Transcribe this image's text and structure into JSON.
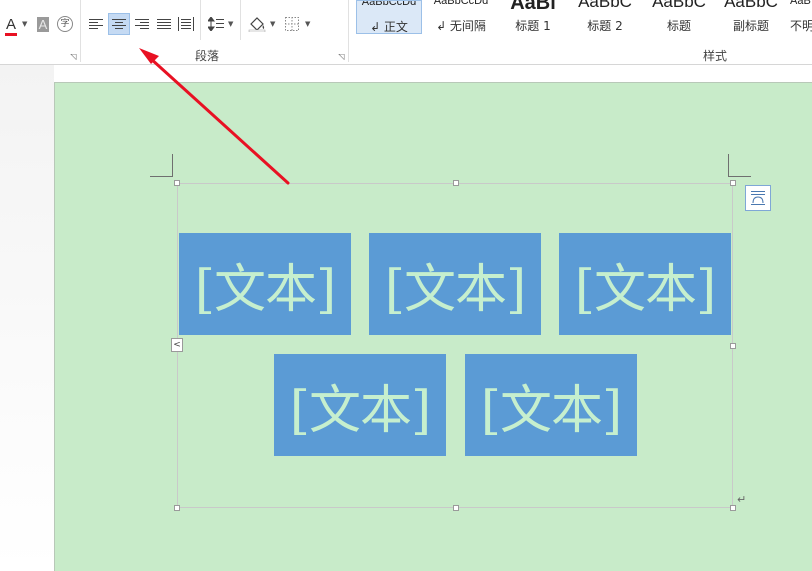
{
  "ribbon": {
    "paragraph_group_label": "段落",
    "styles_group_label": "样式",
    "font_color_glyph": "A",
    "highlight_glyph": "A",
    "phonetic_glyph": "字",
    "font_color_accent": "#e81123",
    "styles": [
      {
        "preview": "AaBbCcDd",
        "name": "↲ 正文",
        "selected": true
      },
      {
        "preview": "AaBbCcDd",
        "name": "↲ 无间隔",
        "selected": false
      },
      {
        "preview": "AaBl",
        "name": "标题 1",
        "selected": false
      },
      {
        "preview": "AaBbC",
        "name": "标题 2",
        "selected": false
      },
      {
        "preview": "AaBbC",
        "name": "标题",
        "selected": false
      },
      {
        "preview": "AaBbC",
        "name": "副标题",
        "selected": false
      },
      {
        "preview": "AaB",
        "name": "不明",
        "selected": false
      }
    ]
  },
  "document": {
    "page_color": "#c8ebc9",
    "box_color": "#5b9bd5",
    "box_text_color": "#c6efce",
    "text_boxes": [
      "[文本]",
      "[文本]",
      "[文本]",
      "[文本]",
      "[文本]"
    ],
    "paragraph_mark": "↵",
    "collapse_glyph": "<"
  },
  "annotation": {
    "arrow_color": "#e81123"
  }
}
